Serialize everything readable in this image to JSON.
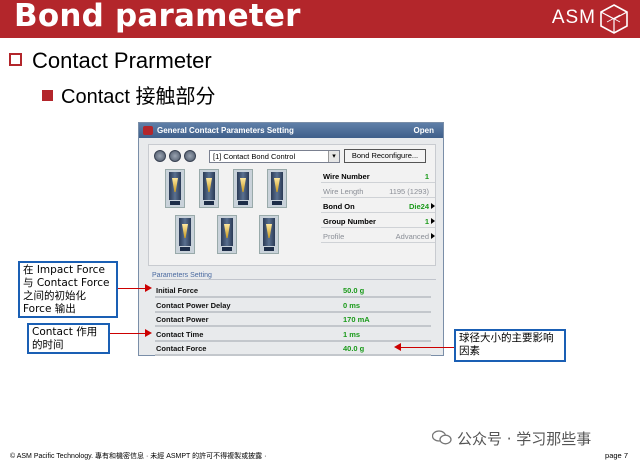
{
  "header": {
    "title": "Bond parameter",
    "brand": "ASM"
  },
  "bullets": {
    "level1": "Contact Prarmeter",
    "level2": "Contact  接触部分"
  },
  "dialog": {
    "title": "General Contact Parameters Setting",
    "open_label": "Open",
    "select_value": "[1] Contact Bond Control",
    "reconfigure_label": "Bond Reconfigure...",
    "props": [
      {
        "label": "Wire Number",
        "value": "1",
        "style": "bold"
      },
      {
        "label": "Wire Length",
        "value": "1195 (1293)",
        "style": "grey"
      },
      {
        "label": "Bond On",
        "value": "Die24",
        "style": "bold"
      },
      {
        "label": "Group Number",
        "value": "1",
        "style": "bold"
      },
      {
        "label": "Profile",
        "value": "Advanced",
        "style": "grey"
      }
    ],
    "parameters_heading": "Parameters Setting",
    "parameters": [
      {
        "label": "Initial Force",
        "value": "50.0  g"
      },
      {
        "label": "Contact Power Delay",
        "value": "0  ms"
      },
      {
        "label": "Contact Power",
        "value": "170  mA"
      },
      {
        "label": "Contact Time",
        "value": "1  ms"
      },
      {
        "label": "Contact Force",
        "value": "40.0  g"
      }
    ]
  },
  "notes": {
    "impact": "在 Impact Force 与 Contact Force 之间的初始化 Force 输出",
    "contact_time": "Contact  作用的时间",
    "ball_size": "球径大小的主要影响因素"
  },
  "footer": {
    "copyright": "© ASM Pacific Technology.   專有和機密信息 · 未經  ASMPT  的許可不得複製或披露 ·",
    "page": "page 7",
    "watermark": "公众号 · 学习那些事"
  },
  "colors": {
    "accent": "#b3262b",
    "note_border": "#1a5fb4",
    "value_green": "#1a9a1a"
  }
}
